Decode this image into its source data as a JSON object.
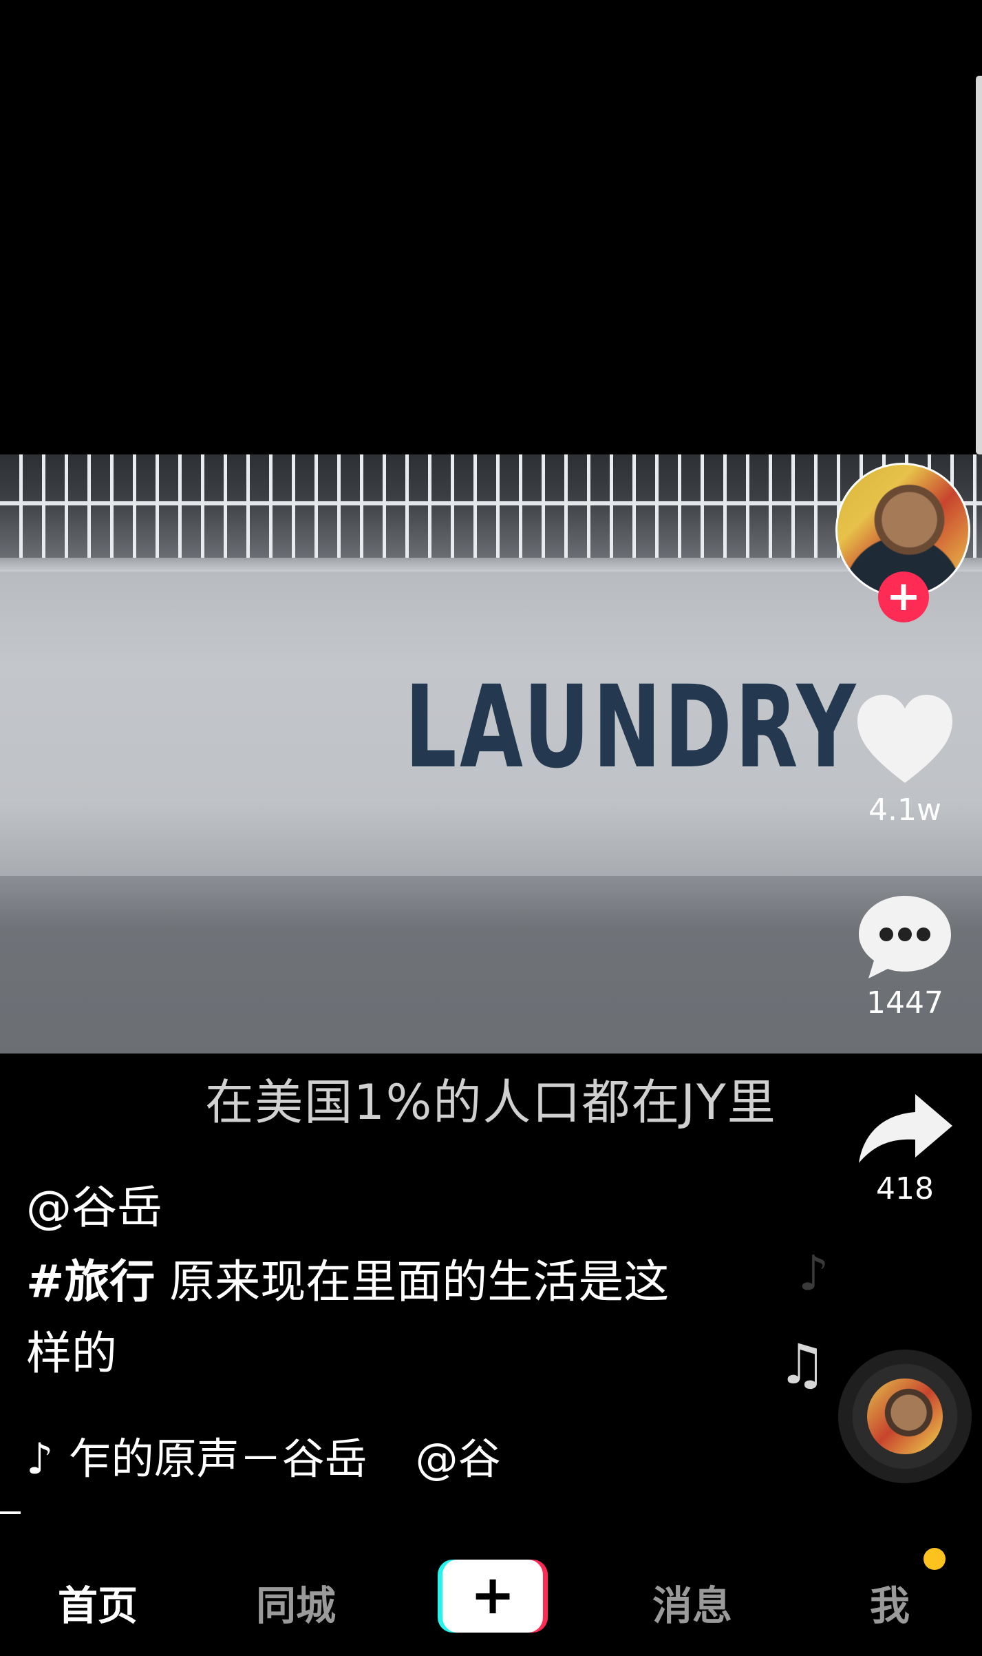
{
  "video": {
    "scene_text": "LAUNDRY",
    "subtitle": "在美国1%的人口都在JY里"
  },
  "rail": {
    "like_count": "4.1w",
    "comment_count": "1447",
    "share_count": "418",
    "follow_symbol": "+"
  },
  "caption": {
    "author": "@谷岳",
    "hashtag": "#旅行",
    "text": " 原来现在里面的生活是这样的",
    "music_title": "乍的原声－谷岳",
    "music_mention": "@谷"
  },
  "tabs": {
    "home": "首页",
    "nearby": "同城",
    "create": "+",
    "messages": "消息",
    "me": "我"
  },
  "icons": {
    "music_note": "♪",
    "floating_note_1": "♪",
    "floating_note_2": "♫"
  },
  "colors": {
    "accent_red": "#fe2c55",
    "accent_cyan": "#25f4ee",
    "badge_yellow": "#fcc31f"
  }
}
